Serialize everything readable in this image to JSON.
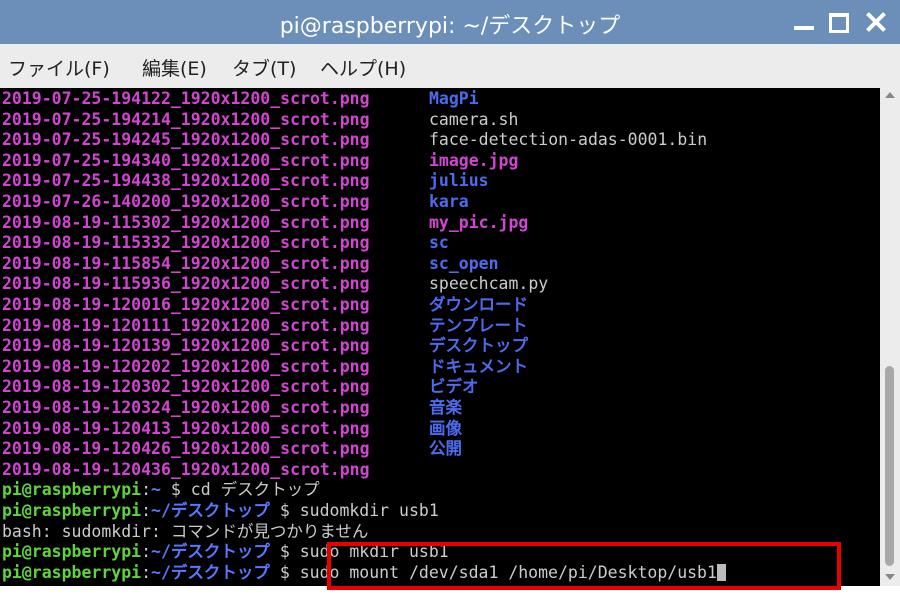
{
  "window": {
    "title": "pi@raspberrypi: ~/デスクトップ",
    "controls": [
      "minimize-icon",
      "maximize-icon",
      "close-icon"
    ]
  },
  "menu": [
    "ファイル(F)",
    "編集(E)",
    "タブ(T)",
    "ヘルプ(H)"
  ],
  "listing": [
    {
      "left": "2019-07-25-194122_1920x1200_scrot.png",
      "right": "MagPi",
      "right_type": "dir"
    },
    {
      "left": "2019-07-25-194214_1920x1200_scrot.png",
      "right": "camera.sh",
      "right_type": "plain"
    },
    {
      "left": "2019-07-25-194245_1920x1200_scrot.png",
      "right": "face-detection-adas-0001.bin",
      "right_type": "plain"
    },
    {
      "left": "2019-07-25-194340_1920x1200_scrot.png",
      "right": "image.jpg",
      "right_type": "img"
    },
    {
      "left": "2019-07-25-194438_1920x1200_scrot.png",
      "right": "julius",
      "right_type": "dir"
    },
    {
      "left": "2019-07-26-140200_1920x1200_scrot.png",
      "right": "kara",
      "right_type": "dir"
    },
    {
      "left": "2019-08-19-115302_1920x1200_scrot.png",
      "right": "my_pic.jpg",
      "right_type": "img"
    },
    {
      "left": "2019-08-19-115332_1920x1200_scrot.png",
      "right": "sc",
      "right_type": "dir"
    },
    {
      "left": "2019-08-19-115854_1920x1200_scrot.png",
      "right": "sc_open",
      "right_type": "dir"
    },
    {
      "left": "2019-08-19-115936_1920x1200_scrot.png",
      "right": "speechcam.py",
      "right_type": "plain"
    },
    {
      "left": "2019-08-19-120016_1920x1200_scrot.png",
      "right": "ダウンロード",
      "right_type": "dir"
    },
    {
      "left": "2019-08-19-120111_1920x1200_scrot.png",
      "right": "テンプレート",
      "right_type": "dir"
    },
    {
      "left": "2019-08-19-120139_1920x1200_scrot.png",
      "right": "デスクトップ",
      "right_type": "dir"
    },
    {
      "left": "2019-08-19-120202_1920x1200_scrot.png",
      "right": "ドキュメント",
      "right_type": "dir"
    },
    {
      "left": "2019-08-19-120302_1920x1200_scrot.png",
      "right": "ビデオ",
      "right_type": "dir"
    },
    {
      "left": "2019-08-19-120324_1920x1200_scrot.png",
      "right": "音楽",
      "right_type": "dir"
    },
    {
      "left": "2019-08-19-120413_1920x1200_scrot.png",
      "right": "画像",
      "right_type": "dir"
    },
    {
      "left": "2019-08-19-120426_1920x1200_scrot.png",
      "right": "公開",
      "right_type": "dir"
    },
    {
      "left": "2019-08-19-120436_1920x1200_scrot.png",
      "right": "",
      "right_type": "dir"
    }
  ],
  "prompt_user": "pi@raspberrypi",
  "commands": [
    {
      "path": "~",
      "dollar": " $ ",
      "cmd": "cd デスクトップ"
    },
    {
      "path": "~/デスクトップ",
      "dollar": " $ ",
      "cmd": "sudomkdir usb1"
    },
    {
      "output": "bash: sudomkdir: コマンドが見つかりません"
    },
    {
      "path": "~/デスクトップ",
      "dollar": " $ ",
      "cmd": "sudo mkdir usb1"
    },
    {
      "path": "~/デスクトップ",
      "dollar": " $ ",
      "cmd": "sudo mount /dev/sda1 /home/pi/Desktop/usb1"
    }
  ],
  "colors": {
    "titlebar": "#6b8fb8",
    "terminal_bg": "#000000",
    "filename_magenta": "#d245d2",
    "directory_blue": "#4e6bef",
    "prompt_green": "#5ed53b",
    "highlight_red": "#e80000"
  }
}
